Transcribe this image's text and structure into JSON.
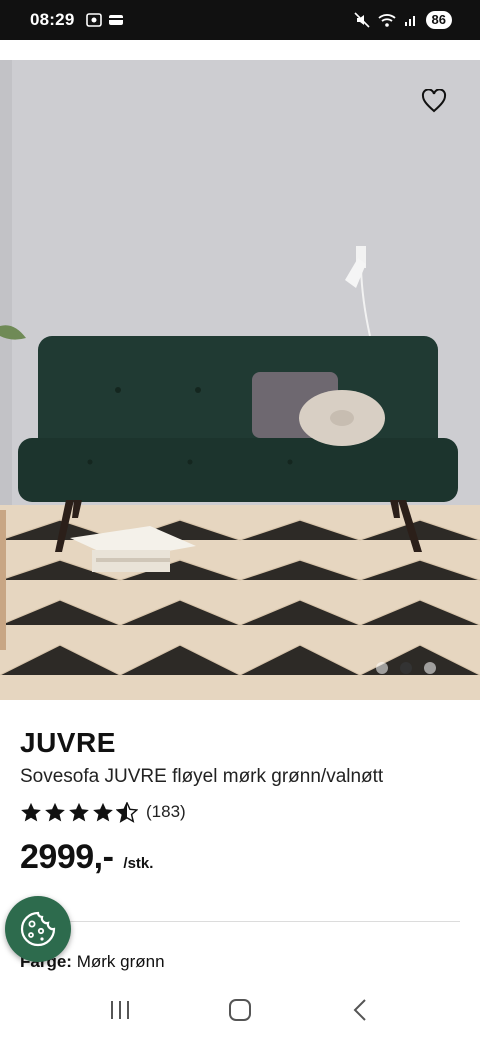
{
  "status_bar": {
    "time": "08:29",
    "battery": "86"
  },
  "product": {
    "brand": "JUVRE",
    "title": "Sovesofa JUVRE fløyel mørk grønn/valnøtt",
    "rating": 4.5,
    "review_count": "(183)",
    "price": "2999,-",
    "price_unit": "/stk.",
    "color_label": "Farge:",
    "color_value": "Mørk grønn"
  },
  "carousel": {
    "slides": 3,
    "active_index": 1
  },
  "colors": {
    "accent_green": "#2d6b4d",
    "sofa_green": "#1f3a33",
    "star": "#111111"
  },
  "icons": {
    "wishlist": "heart-icon",
    "cookie": "cookie-icon",
    "nav_recents": "recents-icon",
    "nav_home": "home-icon",
    "nav_back": "back-icon"
  }
}
